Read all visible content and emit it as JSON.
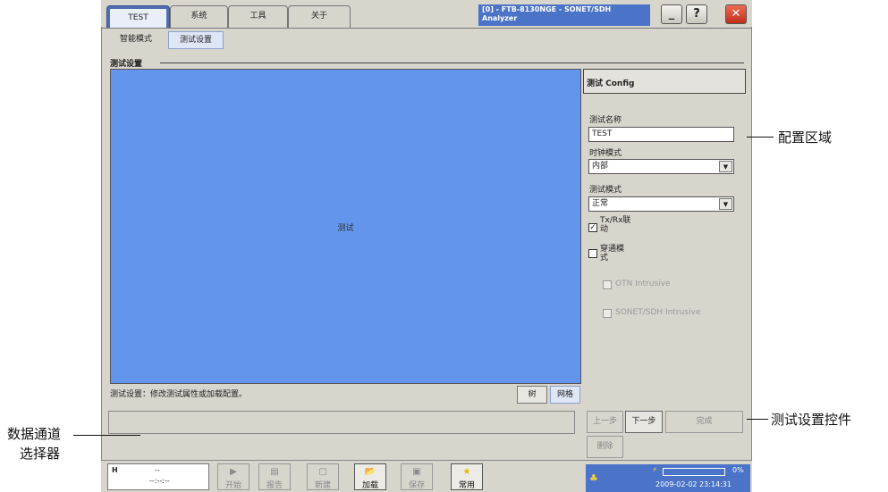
{
  "tabs": [
    "TEST",
    "系统",
    "工具",
    "关于"
  ],
  "title_line1": "[0] - FTB-8130NGE - SONET/SDH",
  "title_line2": "Analyzer",
  "window_buttons": {
    "minimize": "_",
    "help": "?",
    "close": "✕"
  },
  "subtabs": [
    "智能模式",
    "测试设置"
  ],
  "section_title": "测试设置",
  "canvas_label": "测试",
  "config_panel": {
    "title": "测试 Config",
    "test_name_label": "测试名称",
    "test_name_value": "TEST",
    "clock_mode_label": "时钟模式",
    "clock_mode_value": "内部",
    "test_mode_label": "测试模式",
    "test_mode_value": "正常",
    "txrx_line1": "Tx/Rx联",
    "txrx_line2": "动",
    "passthrough_line1": "穿通模",
    "passthrough_line2": "式",
    "otn_intrusive": "OTN Intrusive",
    "sonet_intrusive": "SONET/SDH Intrusive"
  },
  "status_text": "测试设置：修改测试属性或加载配置。",
  "view_buttons": {
    "tree": "树",
    "grid": "网格"
  },
  "nav_buttons": {
    "prev": "上一步",
    "next": "下一步",
    "finish": "完成",
    "delete": "删除"
  },
  "channel_box": {
    "label": "H",
    "value1": "--",
    "value2": "--:--:--"
  },
  "toolbar": [
    {
      "label": "开始",
      "icon": "▶",
      "enabled": false
    },
    {
      "label": "报告",
      "icon": "▤",
      "enabled": false
    },
    {
      "label": "新建",
      "icon": "▢",
      "enabled": false
    },
    {
      "label": "加载",
      "icon": "📂",
      "enabled": true
    },
    {
      "label": "保存",
      "icon": "▣",
      "enabled": false
    },
    {
      "label": "常用",
      "icon": "★",
      "enabled": true
    }
  ],
  "status_box": {
    "percent": "0%",
    "datetime": "2009-02-02 23:14:31"
  },
  "callouts": {
    "config_area": "配置区域",
    "test_controls": "测试设置控件",
    "channel_selector_line1": "数据通道",
    "channel_selector_line2": "选择器"
  }
}
